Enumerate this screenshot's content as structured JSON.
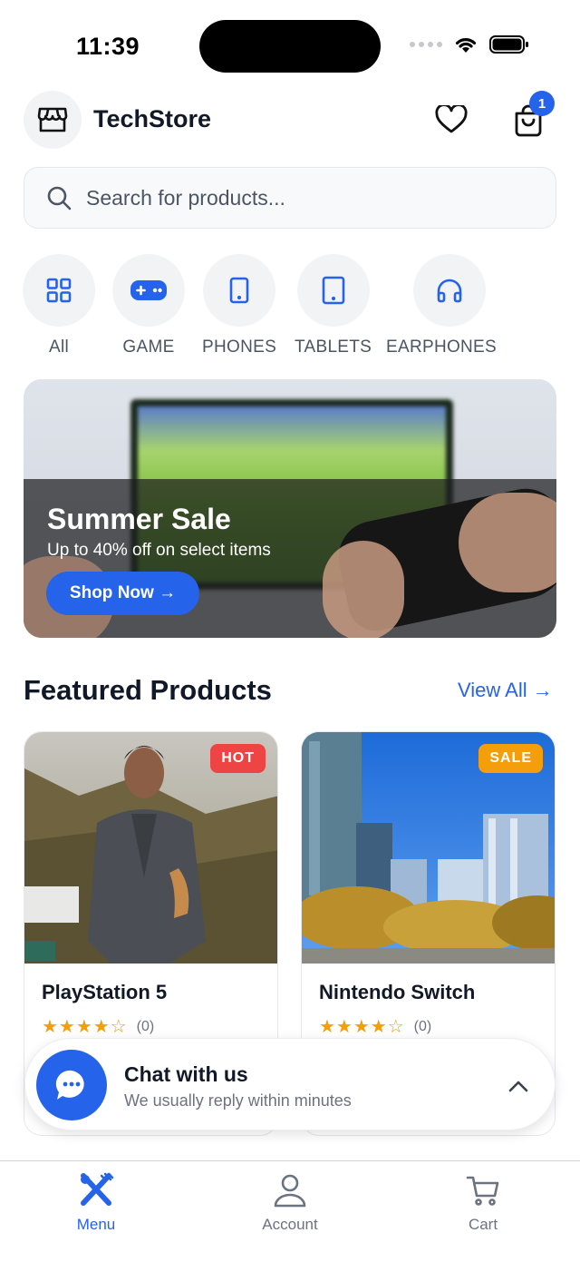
{
  "status_bar": {
    "time": "11:39"
  },
  "header": {
    "brand": "TechStore",
    "cart_count": "1",
    "icons": {
      "logo": "storefront-icon",
      "wishlist": "heart-icon",
      "cart": "shopping-bag-icon"
    }
  },
  "search": {
    "placeholder": "Search for products..."
  },
  "categories": [
    {
      "label": "All",
      "icon": "grid-icon"
    },
    {
      "label": "GAME",
      "icon": "gamepad-icon"
    },
    {
      "label": "PHONES",
      "icon": "phone-icon"
    },
    {
      "label": "TABLETS",
      "icon": "tablet-icon"
    },
    {
      "label": "EARPHONES",
      "icon": "headphones-icon"
    }
  ],
  "banner": {
    "title": "Summer Sale",
    "subtitle": "Up to 40% off on select items",
    "button": "Shop Now →"
  },
  "featured": {
    "title": "Featured Products",
    "view_all": "View All →",
    "products": [
      {
        "name": "PlayStation 5",
        "badge": "HOT",
        "badge_color": "#ef4444",
        "stars": "★★★★☆",
        "rating_count": "(0)"
      },
      {
        "name": "Nintendo Switch",
        "badge": "SALE",
        "badge_color": "#f59e0b",
        "stars": "★★★★☆",
        "rating_count": "(0)"
      }
    ]
  },
  "chat": {
    "title": "Chat with us",
    "subtitle": "We usually reply within minutes"
  },
  "tabbar": {
    "items": [
      {
        "label": "Menu",
        "icon": "fork-knife-icon",
        "active": true
      },
      {
        "label": "Account",
        "icon": "person-icon",
        "active": false
      },
      {
        "label": "Cart",
        "icon": "cart-icon",
        "active": false
      }
    ]
  },
  "colors": {
    "primary": "#2563eb",
    "hot": "#ef4444",
    "sale": "#f59e0b",
    "star": "#f59e0b"
  }
}
